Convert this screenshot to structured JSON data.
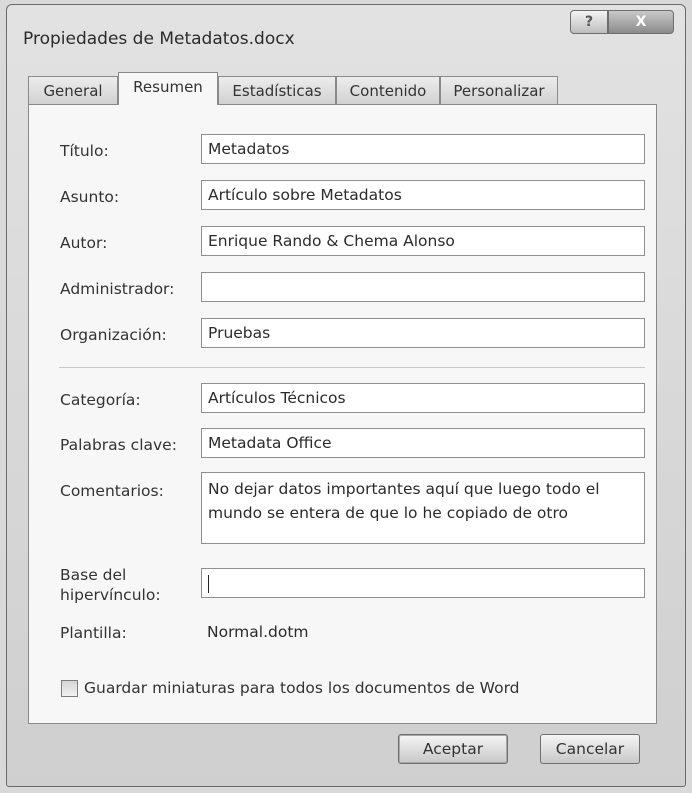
{
  "window": {
    "title": "Propiedades de Metadatos.docx"
  },
  "title_controls": {
    "help": "?",
    "close": "X"
  },
  "tabs": [
    {
      "label": "General"
    },
    {
      "label": "Resumen"
    },
    {
      "label": "Estadísticas"
    },
    {
      "label": "Contenido"
    },
    {
      "label": "Personalizar"
    }
  ],
  "active_tab": "Resumen",
  "fields": {
    "titulo": {
      "label": "Título:",
      "value": "Metadatos"
    },
    "asunto": {
      "label": "Asunto:",
      "value": "Artículo sobre Metadatos"
    },
    "autor": {
      "label": "Autor:",
      "value": "Enrique Rando & Chema Alonso"
    },
    "administrador": {
      "label": "Administrador:",
      "value": ""
    },
    "organizacion": {
      "label": "Organización:",
      "value": "Pruebas"
    },
    "categoria": {
      "label": "Categoría:",
      "value": "Artículos Técnicos"
    },
    "palabras_clave": {
      "label": "Palabras clave:",
      "value": "Metadata Office"
    },
    "comentarios": {
      "label": "Comentarios:",
      "value": "No dejar datos importantes aquí que luego todo el mundo se entera de que lo he copiado de otro"
    },
    "base_hipervinculo": {
      "label_line1": "Base del",
      "label_line2": "hipervínculo:",
      "value": ""
    },
    "plantilla": {
      "label": "Plantilla:",
      "value": "Normal.dotm"
    }
  },
  "checkbox": {
    "label": "Guardar miniaturas para todos los documentos de Word",
    "checked": false
  },
  "buttons": {
    "ok": "Aceptar",
    "cancel": "Cancelar"
  }
}
